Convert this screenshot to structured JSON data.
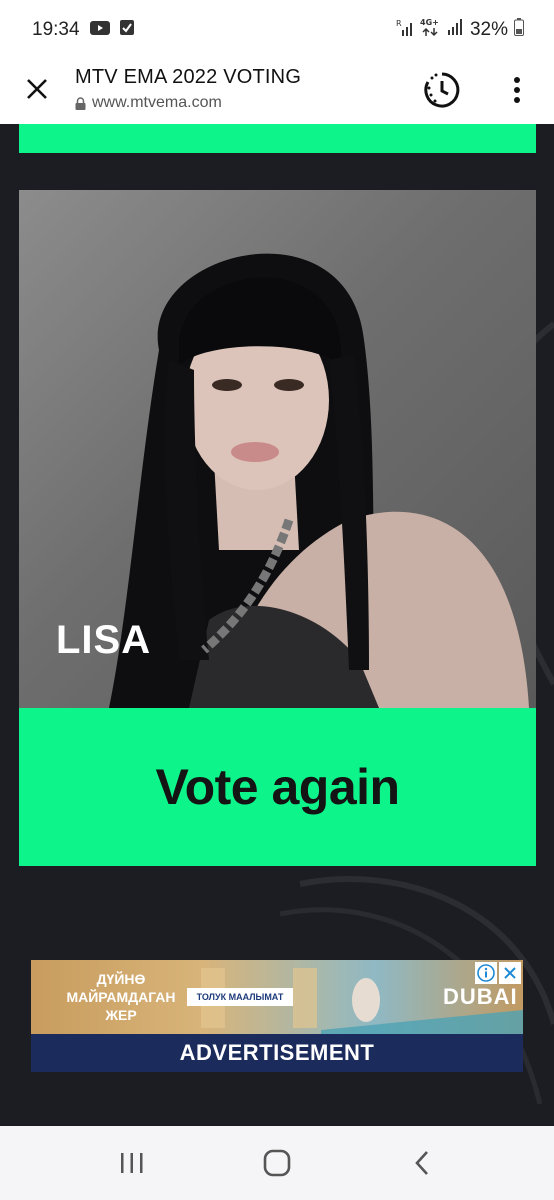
{
  "status_bar": {
    "time": "19:34",
    "battery": "32%",
    "network": "4G+",
    "icons": [
      "youtube-icon",
      "check-notification-icon",
      "signal-r-icon",
      "data-arrows-icon",
      "signal-icon",
      "battery-icon"
    ]
  },
  "browser": {
    "title": "MTV EMA 2022 VOTING",
    "url": "www.mtvema.com",
    "icons": [
      "close-icon",
      "lock-icon",
      "history-timer-icon",
      "more-vert-icon"
    ]
  },
  "card": {
    "artist": "LISA",
    "vote_label": "Vote again"
  },
  "ad": {
    "headline": "ДҮЙНӨ МАЙРАМДАГАН ЖЕР",
    "cta": "ТОЛУК МААЛЫМАТ",
    "brand": "DUBAI",
    "label": "ADVERTISEMENT"
  },
  "nav": {
    "icons": [
      "recent-apps-icon",
      "home-icon",
      "back-icon"
    ]
  },
  "colors": {
    "accent": "#0df58a",
    "background": "#1c1d22",
    "ad_label_bg": "#1a2b5c"
  }
}
